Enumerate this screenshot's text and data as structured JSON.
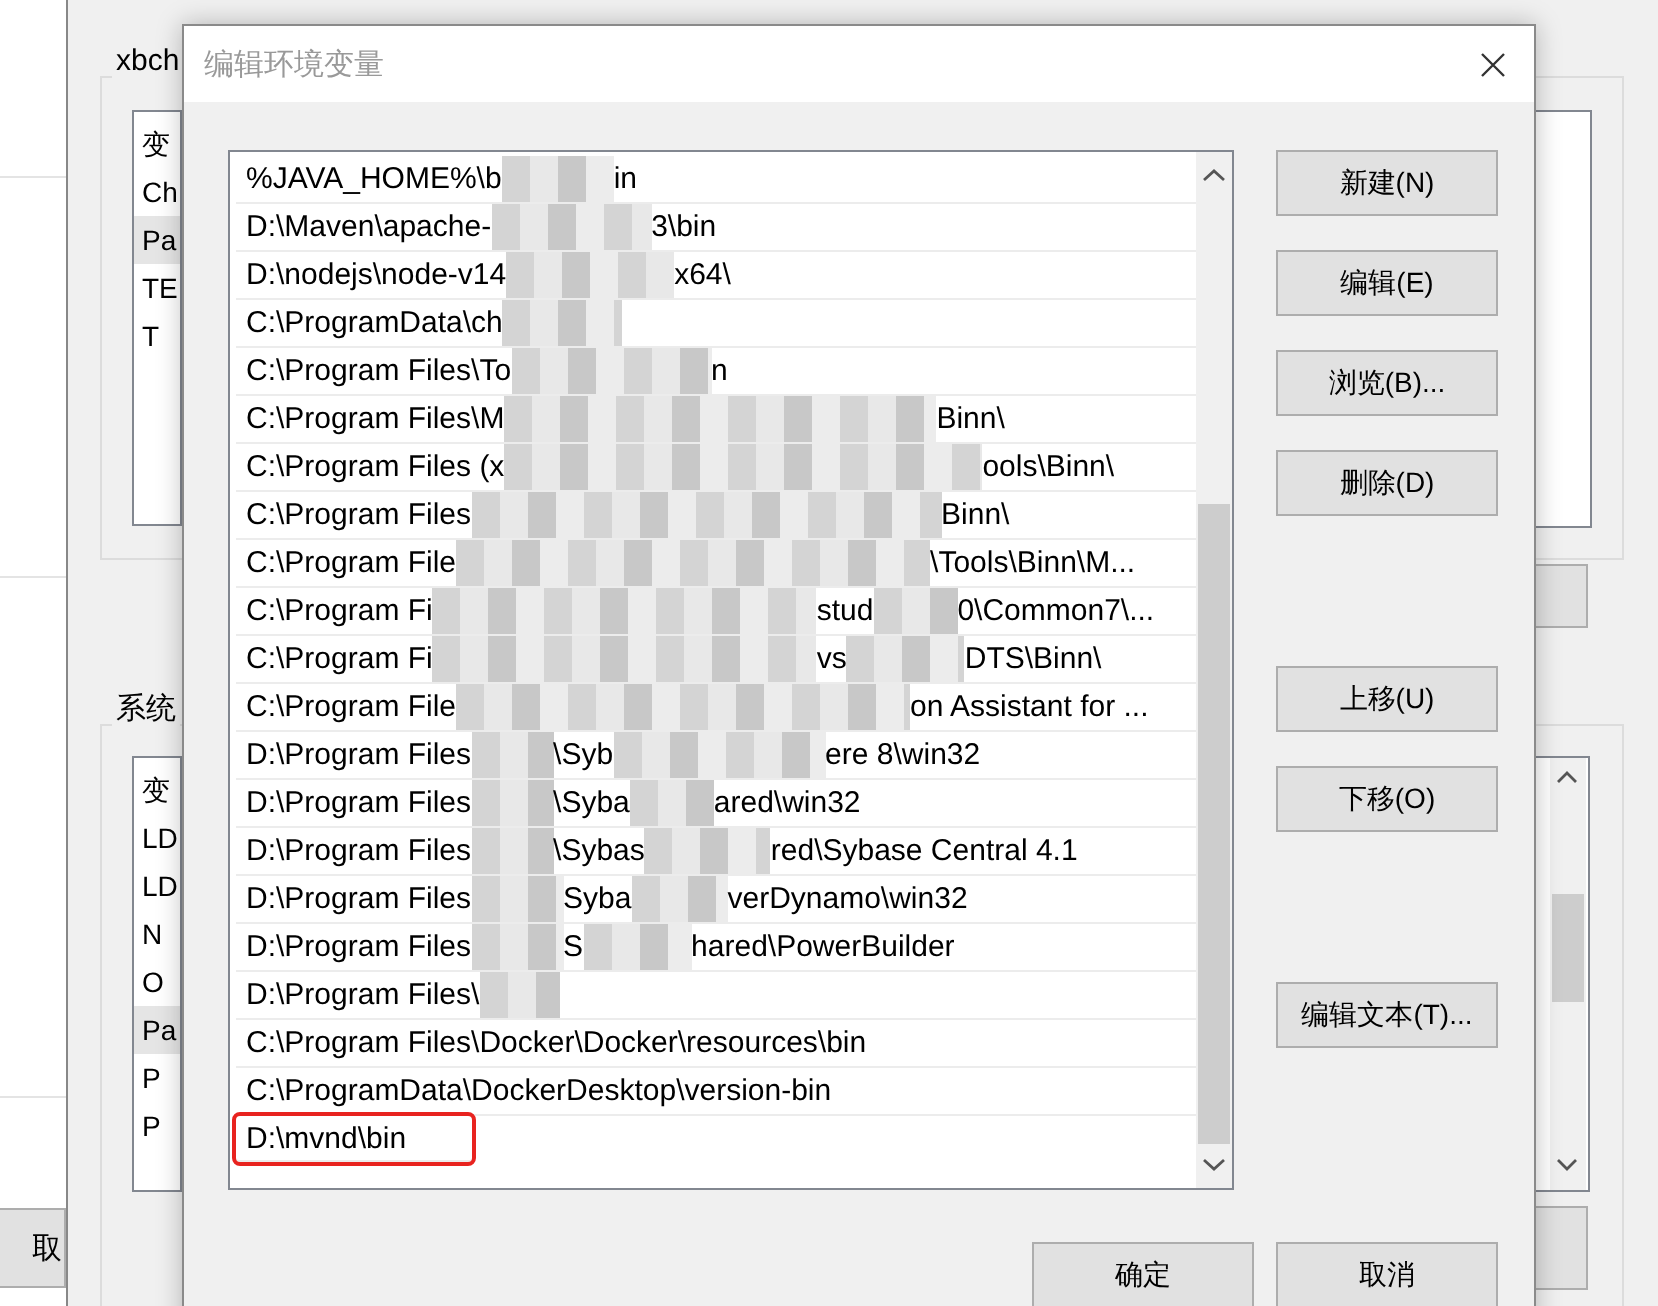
{
  "far_window": {
    "button": "取"
  },
  "background_window": {
    "user_group_label": "xbch",
    "user_variables": [
      {
        "name": "变",
        "selected": false
      },
      {
        "name": "Ch",
        "selected": false
      },
      {
        "name": "Pa",
        "selected": true
      },
      {
        "name": "TE",
        "selected": false
      },
      {
        "name": "T",
        "selected": false
      }
    ],
    "system_group_label": "系统",
    "system_variables": [
      {
        "name": "变",
        "selected": false
      },
      {
        "name": "LD",
        "selected": false
      },
      {
        "name": "LD",
        "selected": false
      },
      {
        "name": "N",
        "selected": false
      },
      {
        "name": "O",
        "selected": false
      },
      {
        "name": "Pa",
        "selected": true
      },
      {
        "name": "P",
        "selected": false
      },
      {
        "name": "P",
        "selected": false
      }
    ]
  },
  "dialog": {
    "title": "编辑环境变量",
    "entries": [
      {
        "parts": [
          "%JAVA_HOME%\\b",
          "in"
        ],
        "annotated": false
      },
      {
        "parts": [
          "D:\\Maven\\apache-",
          "3\\bin"
        ],
        "annotated": false
      },
      {
        "parts": [
          "D:\\nodejs\\node-v14",
          "x64\\"
        ],
        "annotated": false
      },
      {
        "parts": [
          "C:\\ProgramData\\ch"
        ],
        "annotated": false
      },
      {
        "parts": [
          "C:\\Program Files\\To",
          "n"
        ],
        "annotated": false
      },
      {
        "parts": [
          "C:\\Program Files\\M",
          "Binn\\"
        ],
        "annotated": false
      },
      {
        "parts": [
          "C:\\Program Files (x",
          "ools\\Binn\\"
        ],
        "annotated": false
      },
      {
        "parts": [
          "C:\\Program Files",
          "Binn\\"
        ],
        "annotated": false
      },
      {
        "parts": [
          "C:\\Program File",
          "\\Tools\\Binn\\M..."
        ],
        "annotated": false
      },
      {
        "parts": [
          "C:\\Program Fi",
          "stud",
          "0\\Common7\\..."
        ],
        "annotated": false
      },
      {
        "parts": [
          "C:\\Program Fi",
          "vs",
          "DTS\\Binn\\"
        ],
        "annotated": false
      },
      {
        "parts": [
          "C:\\Program File",
          "on Assistant for ..."
        ],
        "annotated": false
      },
      {
        "parts": [
          "D:\\Program Files",
          "\\Syb",
          "ere 8\\win32"
        ],
        "annotated": false
      },
      {
        "parts": [
          "D:\\Program Files",
          "\\Syba",
          "ared\\win32"
        ],
        "annotated": false
      },
      {
        "parts": [
          "D:\\Program Files",
          "\\Sybas",
          "red\\Sybase Central 4.1"
        ],
        "annotated": false
      },
      {
        "parts": [
          "D:\\Program Files",
          "Syba",
          "verDynamo\\win32"
        ],
        "annotated": false
      },
      {
        "parts": [
          "D:\\Program Files",
          "S",
          "hared\\PowerBuilder"
        ],
        "annotated": false
      },
      {
        "parts": [
          "D:\\Program Files\\"
        ],
        "annotated": false
      },
      {
        "parts": [
          "C:\\Program Files\\Docker\\Docker\\resources\\bin"
        ],
        "annotated": false
      },
      {
        "parts": [
          "C:\\ProgramData\\DockerDesktop\\version-bin"
        ],
        "annotated": false
      },
      {
        "parts": [
          "D:\\mvnd\\bin"
        ],
        "annotated": true
      }
    ],
    "side_buttons": [
      {
        "label": "新建(N)",
        "kind": "button"
      },
      {
        "label": "编辑(E)",
        "kind": "button"
      },
      {
        "label": "浏览(B)...",
        "kind": "button"
      },
      {
        "label": "删除(D)",
        "kind": "button"
      },
      {
        "kind": "spacer"
      },
      {
        "label": "上移(U)",
        "kind": "button"
      },
      {
        "label": "下移(O)",
        "kind": "button"
      },
      {
        "kind": "spacer"
      },
      {
        "label": "编辑文本(T)...",
        "kind": "button"
      }
    ],
    "ok_button": "确定",
    "cancel_button": "取消"
  }
}
